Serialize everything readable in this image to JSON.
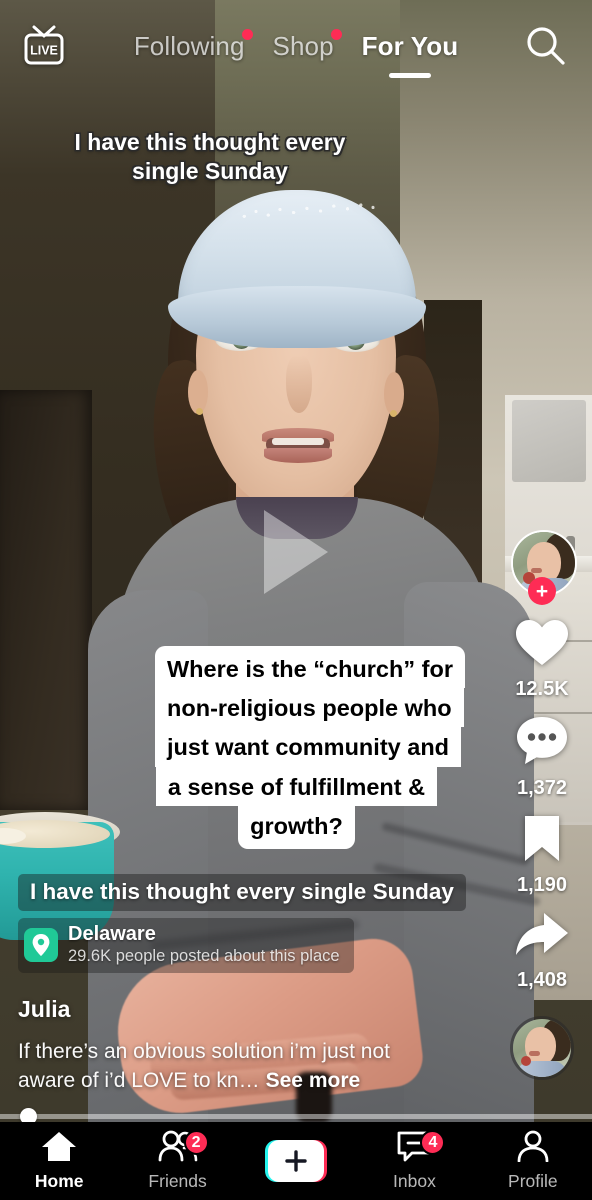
{
  "app": {
    "name": "TikTok",
    "screen": "For You feed"
  },
  "topbar": {
    "live_label": "LIVE",
    "live_icon": "live-tv-icon",
    "search_icon": "search-icon",
    "tabs": [
      {
        "label": "Following",
        "active": false,
        "has_dot": true
      },
      {
        "label": "Shop",
        "active": false,
        "has_dot": true
      },
      {
        "label": "For You",
        "active": true,
        "has_dot": false
      }
    ]
  },
  "video": {
    "subtitle": "I have this thought every\nsingle Sunday",
    "subtitle_line1": "I have this thought every",
    "subtitle_line2": "single Sunday",
    "play_icon": "play-triangle-icon",
    "paused": true,
    "sticker_lines": [
      "Where is the “church” for",
      "non-religious people who",
      "just want community and",
      "a sense of fulfillment &",
      "growth?"
    ],
    "progress_percent": 4
  },
  "rail": {
    "avatar": {
      "name": "creator-avatar",
      "alt": "Julia profile photo"
    },
    "follow_label": "+",
    "actions": [
      {
        "icon": "heart-icon",
        "name": "like-button",
        "count": "12.5K"
      },
      {
        "icon": "comment-icon",
        "name": "comment-button",
        "count": "1,372"
      },
      {
        "icon": "bookmark-icon",
        "name": "bookmark-button",
        "count": "1,190"
      },
      {
        "icon": "share-arrow-icon",
        "name": "share-button",
        "count": "1,408"
      }
    ],
    "music_disc": "music-disc-avatar"
  },
  "info": {
    "caption": "I have this thought every single Sunday",
    "location": {
      "icon": "location-pin-icon",
      "name": "Delaware",
      "subtitle": "29.6K people posted about this place"
    },
    "username": "Julia",
    "description": "If there’s an obvious solution i’m just not aware of i’d LOVE to kn…",
    "see_more_label": "See more"
  },
  "tabbar": {
    "items": [
      {
        "label": "Home",
        "icon": "home-icon",
        "active": true,
        "badge": ""
      },
      {
        "label": "Friends",
        "icon": "friends-icon",
        "active": false,
        "badge": "2"
      },
      {
        "label": "",
        "icon": "create-plus-icon",
        "active": false,
        "badge": ""
      },
      {
        "label": "Inbox",
        "icon": "inbox-icon",
        "active": false,
        "badge": "4"
      },
      {
        "label": "Profile",
        "icon": "profile-icon",
        "active": false,
        "badge": ""
      }
    ],
    "create_plus": "+"
  },
  "colors": {
    "accent_pink": "#fe2c55",
    "accent_cyan": "#25f4ee",
    "location_green": "#20c997",
    "bg_black": "#000000"
  }
}
